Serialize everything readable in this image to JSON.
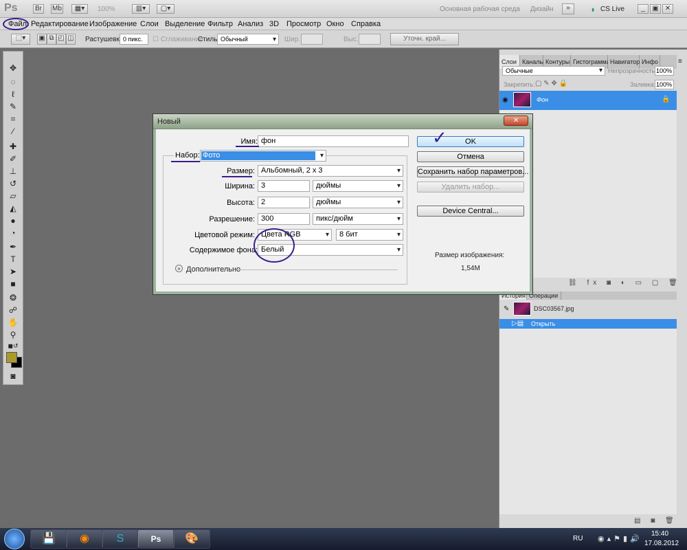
{
  "app": {
    "logo": "Ps",
    "zoom": "100%",
    "workspace_label": "Основная рабочая среда",
    "design_label": "Дизайн",
    "cslive": "CS Live",
    "accent": "#3a8ee6"
  },
  "menu": [
    "Файл",
    "Редактирование",
    "Изображение",
    "Слои",
    "Выделение",
    "Фильтр",
    "Анализ",
    "3D",
    "Просмотр",
    "Окно",
    "Справка"
  ],
  "options": {
    "feather_label": "Растушевка:",
    "feather_value": "0 пикс.",
    "antialias_label": "Сглаживание",
    "style_label": "Стиль:",
    "style_value": "Обычный",
    "width_label": "Шир.:",
    "height_label": "Выс.:",
    "refine_button": "Уточн. край..."
  },
  "layers_panel": {
    "tabs": [
      "Слои",
      "Каналы",
      "Контуры",
      "Гистограмма",
      "Навигатор",
      "Инфо"
    ],
    "blend_mode": "Обычные",
    "opacity_label": "Непрозрачность:",
    "opacity_value": "100%",
    "lock_label": "Закрепить:",
    "fill_label": "Заливка:",
    "fill_value": "100%",
    "layer_name": "Фон"
  },
  "history_panel": {
    "tabs": [
      "История",
      "Операции"
    ],
    "snapshot": "DSC03567.jpg",
    "step": "Открыть"
  },
  "dialog": {
    "title": "Новый",
    "name_label": "Имя:",
    "name_value": "фон",
    "preset_label": "Набор:",
    "preset_value": "Фото",
    "size_label": "Размер:",
    "size_value": "Альбомный, 2 x 3",
    "width_label": "Ширина:",
    "width_value": "3",
    "width_unit": "дюймы",
    "height_label": "Высота:",
    "height_value": "2",
    "height_unit": "дюймы",
    "resolution_label": "Разрешение:",
    "resolution_value": "300",
    "resolution_unit": "пикс/дюйм",
    "colormode_label": "Цветовой режим:",
    "colormode_value": "Цвета RGB",
    "bitdepth_value": "8 бит",
    "bg_label": "Содержимое фона:",
    "bg_value": "Белый",
    "advanced_label": "Дополнительно",
    "ok_button": "OK",
    "cancel_button": "Отмена",
    "save_preset_button": "Сохранить набор параметров...",
    "delete_preset_button": "Удалить набор...",
    "device_central_button": "Device Central...",
    "image_size_label": "Размер изображения:",
    "image_size_value": "1,54M"
  },
  "taskbar": {
    "lang": "RU",
    "time": "15:40",
    "date": "17.08.2012"
  }
}
